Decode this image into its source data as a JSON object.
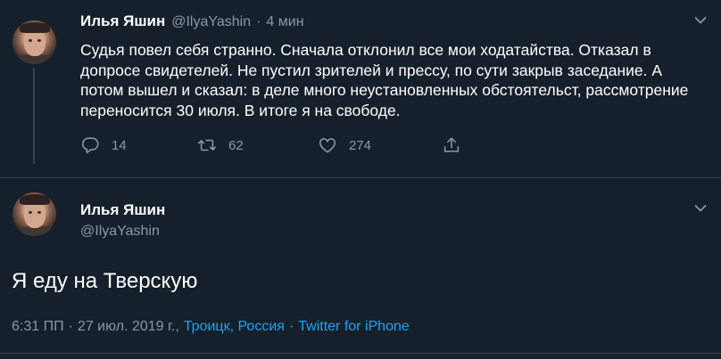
{
  "parent_tweet": {
    "author_name": "Илья Яшин",
    "handle": "@IlyaYashin",
    "separator": "·",
    "time_ago": "4 мин",
    "text": "Судья повел себя странно. Сначала отклонил все мои ходатайства. Отказал в допросе свидетелей. Не пустил зрителей и прессу, по сути закрыв заседание. А потом вышел и сказал: в деле много неустановленных обстоятельст, рассмотрение переносится 30 июля. В итоге я на свободе.",
    "replies": "14",
    "retweets": "62",
    "likes": "274"
  },
  "focused_tweet": {
    "author_name": "Илья Яшин",
    "handle": "@IlyaYashin",
    "text": "Я еду на Тверскую",
    "time": "6:31 ПП",
    "dot1": "·",
    "date": "27 июл. 2019 г.,",
    "location": "Троицк, Россия",
    "dot2": "·",
    "source": "Twitter for iPhone"
  },
  "icons": {
    "reply": "reply-icon",
    "retweet": "retweet-icon",
    "like": "heart-icon",
    "share": "share-icon",
    "more": "chevron-down-icon"
  },
  "colors": {
    "background": "#15202b",
    "text": "#ffffff",
    "secondary": "#8899a6",
    "link": "#1da1f2",
    "border": "#38444d"
  }
}
